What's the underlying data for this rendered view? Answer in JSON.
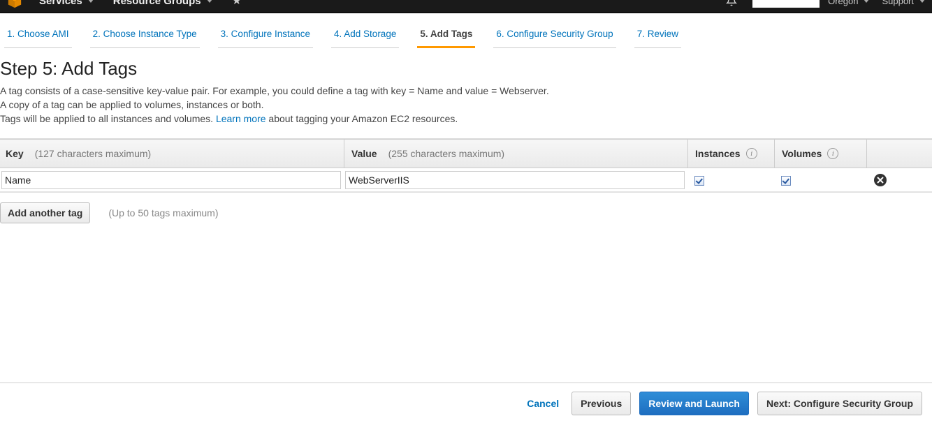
{
  "topnav": {
    "services": "Services",
    "resource_groups": "Resource Groups",
    "region": "Oregon",
    "support": "Support"
  },
  "wizard": {
    "tabs": [
      "1. Choose AMI",
      "2. Choose Instance Type",
      "3. Configure Instance",
      "4. Add Storage",
      "5. Add Tags",
      "6. Configure Security Group",
      "7. Review"
    ],
    "active_index": 4
  },
  "page": {
    "title": "Step 5: Add Tags",
    "desc_line1": "A tag consists of a case-sensitive key-value pair. For example, you could define a tag with key = Name and value = Webserver.",
    "desc_line2": "A copy of a tag can be applied to volumes, instances or both.",
    "desc_line3a": "Tags will be applied to all instances and volumes. ",
    "learn_more": "Learn more",
    "desc_line3b": " about tagging your Amazon EC2 resources."
  },
  "table": {
    "headers": {
      "key": "Key",
      "key_hint": "(127 characters maximum)",
      "value": "Value",
      "value_hint": "(255 characters maximum)",
      "instances": "Instances",
      "volumes": "Volumes"
    },
    "row": {
      "key": "Name",
      "value": "WebServerIIS",
      "instances_checked": true,
      "volumes_checked": true
    }
  },
  "add": {
    "button": "Add another tag",
    "hint": "(Up to 50 tags maximum)"
  },
  "footer": {
    "cancel": "Cancel",
    "previous": "Previous",
    "review": "Review and Launch",
    "next": "Next: Configure Security Group"
  }
}
